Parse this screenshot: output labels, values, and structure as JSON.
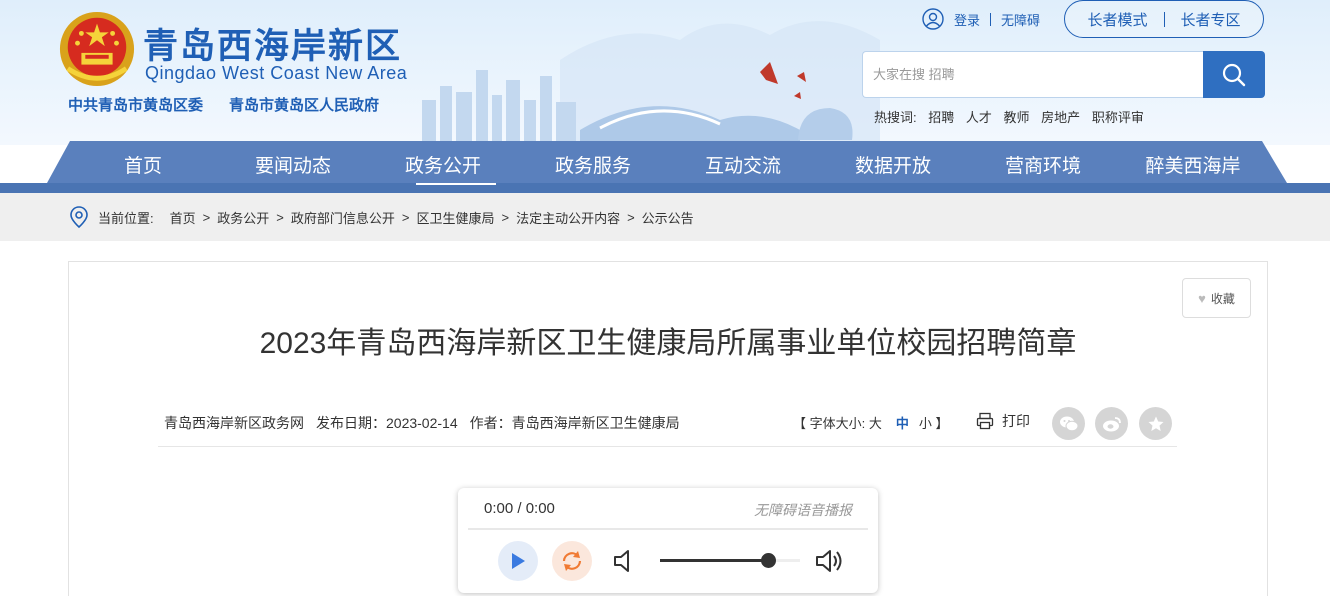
{
  "header": {
    "site_title": "青岛西海岸新区",
    "site_subtitle": "Qingdao West Coast New Area",
    "org_party": "中共青岛市黄岛区委",
    "org_gov": "青岛市黄岛区人民政府",
    "login": "登录",
    "accessibility": "无障碍",
    "elder_mode": "长者模式",
    "elder_zone": "长者专区",
    "search_placeholder": "大家在搜 招聘",
    "hot_label": "热搜词:",
    "hot_words": [
      "招聘",
      "人才",
      "教师",
      "房地产",
      "职称评审"
    ]
  },
  "nav": {
    "items": [
      "首页",
      "要闻动态",
      "政务公开",
      "政务服务",
      "互动交流",
      "数据开放",
      "营商环境",
      "醉美西海岸"
    ],
    "active_index": 2
  },
  "breadcrumb": {
    "label": "当前位置:",
    "items": [
      "首页",
      "政务公开",
      "政府部门信息公开",
      "区卫生健康局",
      "法定主动公开内容",
      "公示公告"
    ]
  },
  "article": {
    "favorite": "收藏",
    "title": "2023年青岛西海岸新区卫生健康局所属事业单位校园招聘简章",
    "source": "青岛西海岸新区政务网",
    "publish_date": "发布日期：2023-02-14",
    "author": "作者：青岛西海岸新区卫生健康局",
    "font_size_label": "【 字体大小: 大",
    "font_size_mid": "中",
    "font_size_small": "小 】",
    "print": "打印",
    "share_icons": [
      "wechat-icon",
      "weibo-icon",
      "favorite-star-icon"
    ]
  },
  "player": {
    "time": "0:00 / 0:00",
    "label": "无障碍语音播报",
    "volume_level": 0.77
  },
  "colors": {
    "brand_blue": "#1f5fb5",
    "nav_blue": "#4a74b3",
    "search_button": "#2f6fc1"
  }
}
